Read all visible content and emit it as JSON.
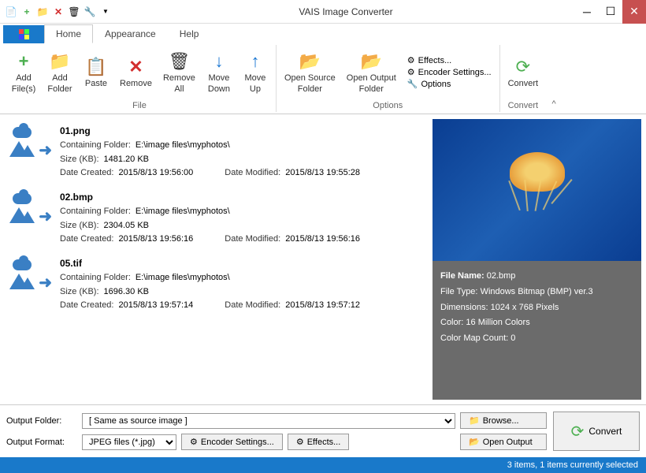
{
  "app": {
    "title": "VAIS Image Converter"
  },
  "tabs": {
    "home": "Home",
    "appearance": "Appearance",
    "help": "Help"
  },
  "ribbon": {
    "add_files": "Add\nFile(s)",
    "add_folder": "Add\nFolder",
    "paste": "Paste",
    "remove": "Remove",
    "remove_all": "Remove\nAll",
    "move_down": "Move\nDown",
    "move_up": "Move\nUp",
    "open_source": "Open Source\nFolder",
    "open_output": "Open Output\nFolder",
    "effects": "Effects...",
    "encoder": "Encoder Settings...",
    "options": "Options",
    "convert": "Convert",
    "grp_file": "File",
    "grp_options": "Options",
    "grp_convert": "Convert"
  },
  "files": [
    {
      "name": "01.png",
      "folder": "E:\\image files\\myphotos\\",
      "size": "1481.20 KB",
      "created": "2015/8/13 19:56:00",
      "modified": "2015/8/13 19:55:28"
    },
    {
      "name": "02.bmp",
      "folder": "E:\\image files\\myphotos\\",
      "size": "2304.05 KB",
      "created": "2015/8/13 19:56:16",
      "modified": "2015/8/13 19:56:16"
    },
    {
      "name": "05.tif",
      "folder": "E:\\image files\\myphotos\\",
      "size": "1696.30 KB",
      "created": "2015/8/13 19:57:14",
      "modified": "2015/8/13 19:57:12"
    }
  ],
  "labels": {
    "containing": "Containing Folder:",
    "size": "Size (KB):",
    "created": "Date Created:",
    "modified": "Date Modified:"
  },
  "preview": {
    "filename_k": "File Name:",
    "filename_v": "02.bmp",
    "filetype_k": "File Type:",
    "filetype_v": "Windows Bitmap (BMP) ver.3",
    "dim_k": "Dimensions:",
    "dim_v": "1024 x 768 Pixels",
    "color_k": "Color:",
    "color_v": "16 Million Colors",
    "cmap_k": "Color Map Count:",
    "cmap_v": "0"
  },
  "bottom": {
    "out_folder_lbl": "Output Folder:",
    "out_folder_val": "[ Same as source image ]",
    "out_format_lbl": "Output Format:",
    "out_format_val": "JPEG files (*.jpg)",
    "encoder": "Encoder Settings...",
    "effects": "Effects...",
    "browse": "Browse...",
    "open_output": "Open Output",
    "convert": "Convert"
  },
  "status": "3 items, 1 items currently selected"
}
